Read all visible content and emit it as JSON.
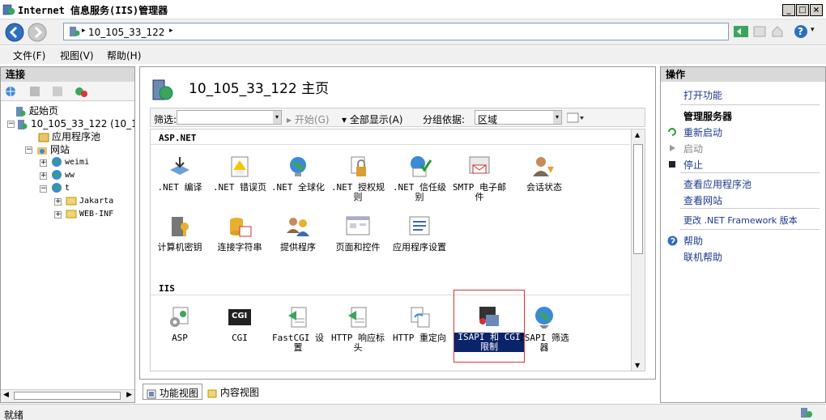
{
  "window": {
    "title": "Internet 信息服务(IIS)管理器",
    "minimize": "_",
    "maximize": "□",
    "close": "×"
  },
  "nav": {
    "address": "10_105_33_122",
    "help_label": "?"
  },
  "menu": {
    "file": "文件(F)",
    "view": "视图(V)",
    "help": "帮助(H)"
  },
  "connections": {
    "header": "连接",
    "tree": {
      "start_page": "起始页",
      "server": "10_105_33_122 (10_10",
      "app_pools": "应用程序池",
      "sites": "网站",
      "weimi": "weimi",
      "ww": "ww",
      "t": "t",
      "jakarta": "Jakarta",
      "webinf": "WEB-INF"
    }
  },
  "center": {
    "title": "10_105_33_122 主页",
    "filter_label": "筛选:",
    "start_btn": "开始(G)",
    "show_all": "全部显示(A)",
    "group_by_label": "分组依据:",
    "group_by_value": "区域",
    "sections": {
      "aspnet": "ASP.NET",
      "iis": "IIS"
    },
    "aspnet_features": [
      ".NET 编译",
      ".NET 错误页",
      ".NET 全球化",
      ".NET 授权规则",
      ".NET 信任级别",
      "SMTP 电子邮件",
      "会话状态",
      "计算机密钥",
      "连接字符串",
      "提供程序",
      "页面和控件",
      "应用程序设置"
    ],
    "iis_features": [
      "ASP",
      "CGI",
      "FastCGI 设置",
      "HTTP 响应标头",
      "HTTP 重定向",
      "ISAPI 和 CGI 限制",
      "ISAPI 筛选器"
    ],
    "cgi_icon_text": "CGI",
    "tab_features": "功能视图",
    "tab_content": "内容视图"
  },
  "actions": {
    "header": "操作",
    "open_feature": "打开功能",
    "manage_server": "管理服务器",
    "restart": "重新启动",
    "start": "启动",
    "stop": "停止",
    "view_app_pools": "查看应用程序池",
    "view_sites": "查看网站",
    "change_framework": "更改 .NET Framework 版本",
    "help": "帮助",
    "online_help": "联机帮助"
  },
  "status": {
    "text": "就绪"
  },
  "colors": {
    "selection": "#0a246a",
    "link": "#1a3a8a",
    "highlight_border": "#dd3333"
  }
}
